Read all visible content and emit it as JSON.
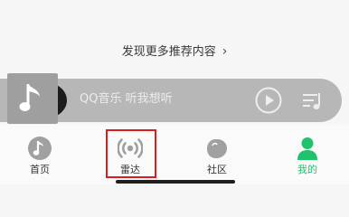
{
  "discover": {
    "label": "发现更多推荐内容",
    "chevron": "›"
  },
  "player": {
    "text": "QQ音乐 听我想听",
    "cover_icon": "music-note-icon",
    "play_icon": "play-icon",
    "playlist_icon": "playlist-icon"
  },
  "nav": {
    "items": [
      {
        "label": "首页",
        "icon": "music-disc-icon",
        "active": false
      },
      {
        "label": "雷达",
        "icon": "radar-icon",
        "active": false
      },
      {
        "label": "社区",
        "icon": "community-icon",
        "active": false
      },
      {
        "label": "我的",
        "icon": "profile-icon",
        "active": true
      }
    ],
    "highlighted_item": "雷达"
  },
  "colors": {
    "accent": "#21c16e",
    "highlight_border": "#d81e1e",
    "icon_gray": "#a0a0a0"
  }
}
